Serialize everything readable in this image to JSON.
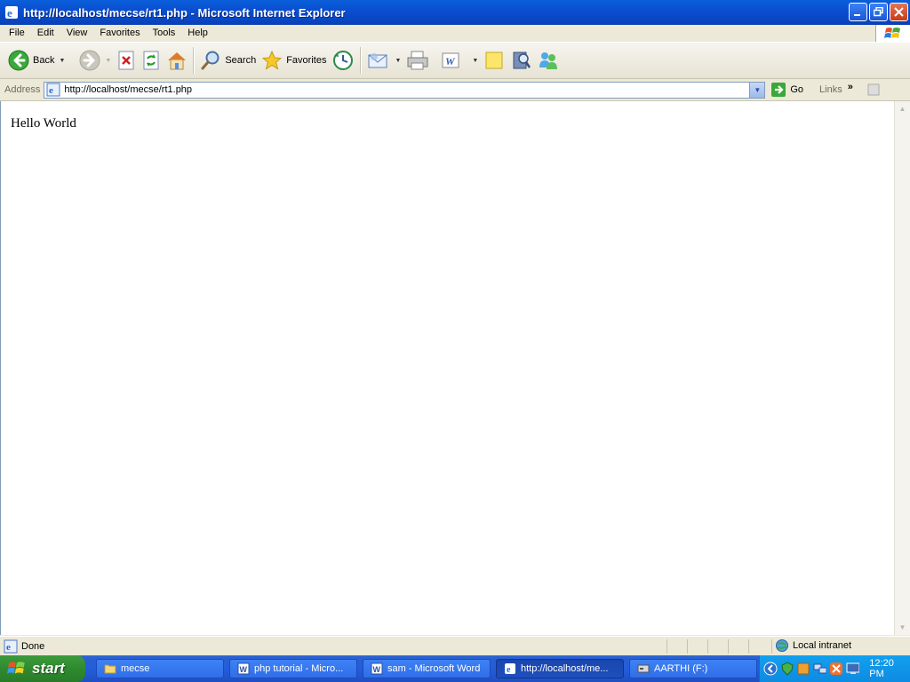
{
  "window": {
    "title": "http://localhost/mecse/rt1.php - Microsoft Internet Explorer"
  },
  "menu": [
    "File",
    "Edit",
    "View",
    "Favorites",
    "Tools",
    "Help"
  ],
  "toolbar": {
    "back_label": "Back",
    "search_label": "Search",
    "favorites_label": "Favorites"
  },
  "address": {
    "label": "Address",
    "url": "http://localhost/mecse/rt1.php",
    "go_label": "Go",
    "links_label": "Links"
  },
  "page": {
    "text": "Hello World"
  },
  "status": {
    "text": "Done",
    "zone": "Local intranet"
  },
  "taskbar": {
    "start_label": "start",
    "tasks": [
      {
        "label": "mecse"
      },
      {
        "label": "php tutorial - Micro..."
      },
      {
        "label": "sam - Microsoft Word"
      },
      {
        "label": "http://localhost/me..."
      },
      {
        "label": "AARTHI (F:)"
      }
    ],
    "clock": "12:20 PM"
  },
  "colors": {
    "titlebar": "#0A4FD0",
    "taskbar": "#245DDB",
    "start_green": "#2F8A2F",
    "tray": "#0E8BE2"
  }
}
